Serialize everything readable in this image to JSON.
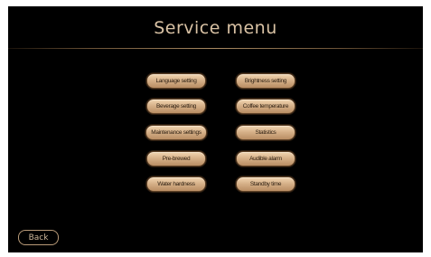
{
  "header": {
    "title": "Service menu"
  },
  "menu": {
    "left": [
      "Language setting",
      "Beverage setting",
      "Maintenance settings",
      "Pre-brewed",
      "Water hardness"
    ],
    "right": [
      "Brightness setting",
      "Coffee temperature",
      "Statistics",
      "Audible alarm",
      "Standby time"
    ]
  },
  "footer": {
    "back_label": "Back"
  },
  "colors": {
    "background": "#000000",
    "title_text": "#d9c2a4",
    "button_fill": "#d7b28a",
    "button_text": "#2b1d10"
  }
}
